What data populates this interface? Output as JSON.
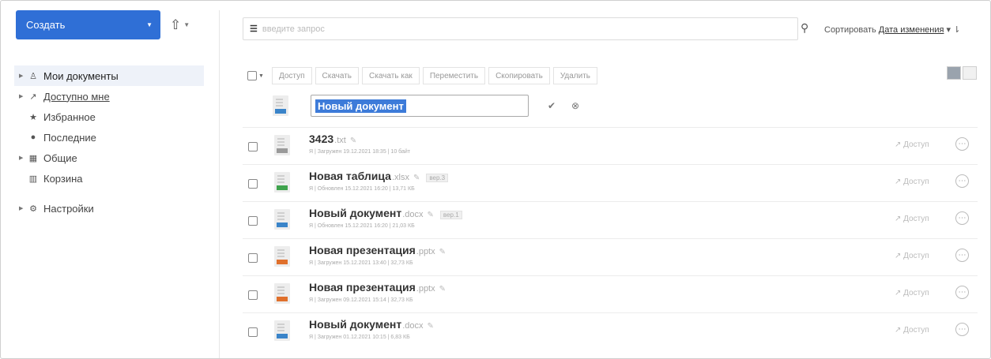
{
  "sidebar": {
    "create_label": "Создать",
    "items": [
      {
        "label": "Мои документы",
        "icon": "user-icon"
      },
      {
        "label": "Доступно мне",
        "icon": "share-icon"
      },
      {
        "label": "Избранное",
        "icon": "star-icon"
      },
      {
        "label": "Последние",
        "icon": "clock-icon"
      },
      {
        "label": "Общие",
        "icon": "shared-folder-icon"
      },
      {
        "label": "Корзина",
        "icon": "trash-icon"
      },
      {
        "label": "Настройки",
        "icon": "gear-icon"
      }
    ]
  },
  "search": {
    "placeholder": "введите запрос"
  },
  "sort": {
    "label": "Сортировать",
    "value": "Дата изменения"
  },
  "toolbar": {
    "access": "Доступ",
    "download": "Скачать",
    "download_as": "Скачать как",
    "move": "Переместить",
    "copy": "Скопировать",
    "delete": "Удалить"
  },
  "new_doc": {
    "name": "Новый документ"
  },
  "files": [
    {
      "name": "3423",
      "ext": ".txt",
      "version": "",
      "meta": "Я | Загружен 19.12.2021 18:35 | 10 байт",
      "access": "Доступ",
      "type": "txt"
    },
    {
      "name": "Новая таблица",
      "ext": ".xlsx",
      "version": "вер.3",
      "meta": "Я | Обновлен 15.12.2021 16:20 | 13,71 КБ",
      "access": "Доступ",
      "type": "xls"
    },
    {
      "name": "Новый документ",
      "ext": ".docx",
      "version": "вер.1",
      "meta": "Я | Обновлен 15.12.2021 16:20 | 21,03 КБ",
      "access": "Доступ",
      "type": "doc"
    },
    {
      "name": "Новая презентация",
      "ext": ".pptx",
      "version": "",
      "meta": "Я | Загружен 15.12.2021 13:40 | 32,73 КБ",
      "access": "Доступ",
      "type": "ppt"
    },
    {
      "name": "Новая презентация",
      "ext": ".pptx",
      "version": "",
      "meta": "Я | Загружен 09.12.2021 15:14 | 32,73 КБ",
      "access": "Доступ",
      "type": "ppt"
    },
    {
      "name": "Новый документ",
      "ext": ".docx",
      "version": "",
      "meta": "Я | Загружен 01.12.2021 10:15 | 6,83 КБ",
      "access": "Доступ",
      "type": "doc"
    }
  ]
}
